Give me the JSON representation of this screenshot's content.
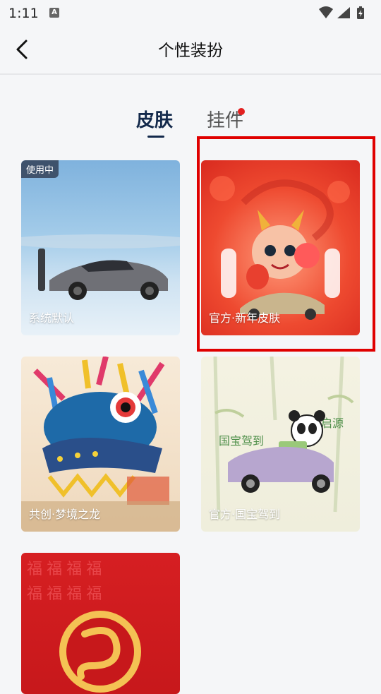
{
  "status_bar": {
    "time": "1:11",
    "notification_letter": "A"
  },
  "header": {
    "title": "个性装扮"
  },
  "tabs": [
    {
      "label": "皮肤",
      "active": true
    },
    {
      "label": "挂件",
      "active": false,
      "has_dot": true
    }
  ],
  "skins": [
    {
      "label": "系统默认",
      "badge": "使用中"
    },
    {
      "label": "官方·新年皮肤",
      "selected": true
    },
    {
      "label": "共创·梦境之龙"
    },
    {
      "label": "官方·国宝驾到"
    },
    {
      "label": ""
    }
  ],
  "colors": {
    "accent": "#13294b",
    "highlight": "#e00000",
    "dot": "#e32020"
  }
}
